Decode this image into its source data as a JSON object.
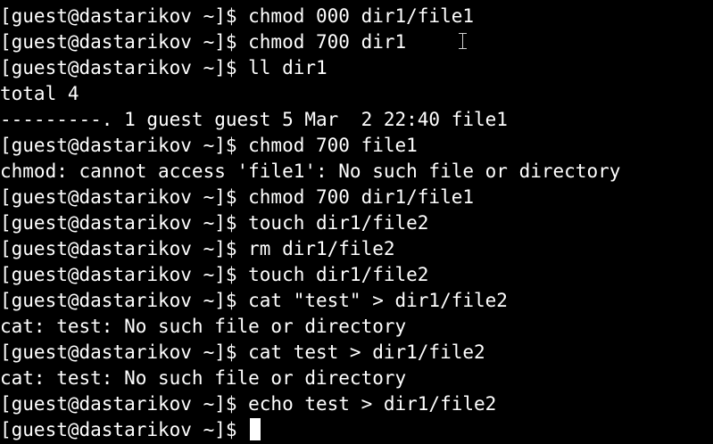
{
  "window": {
    "background": "#000000",
    "foreground": "#ffffff"
  },
  "terminal": {
    "lines": [
      "[guest@dastarikov ~]$ chmod 000 dir1/file1",
      "[guest@dastarikov ~]$ chmod 700 dir1",
      "[guest@dastarikov ~]$ ll dir1",
      "total 4",
      "---------. 1 guest guest 5 Mar  2 22:40 file1",
      "[guest@dastarikov ~]$ chmod 700 file1",
      "chmod: cannot access 'file1': No such file or directory",
      "[guest@dastarikov ~]$ chmod 700 dir1/file1",
      "[guest@dastarikov ~]$ touch dir1/file2",
      "[guest@dastarikov ~]$ rm dir1/file2",
      "[guest@dastarikov ~]$ touch dir1/file2",
      "[guest@dastarikov ~]$ cat \"test\" > dir1/file2",
      "cat: test: No such file or directory",
      "[guest@dastarikov ~]$ cat test > dir1/file2",
      "cat: test: No such file or directory",
      "[guest@dastarikov ~]$ echo test > dir1/file2"
    ],
    "prompt": "[guest@dastarikov ~]$ ",
    "cursor_icon": "text-cursor-icon",
    "mouse_pointer_icon": "i-beam-icon"
  }
}
